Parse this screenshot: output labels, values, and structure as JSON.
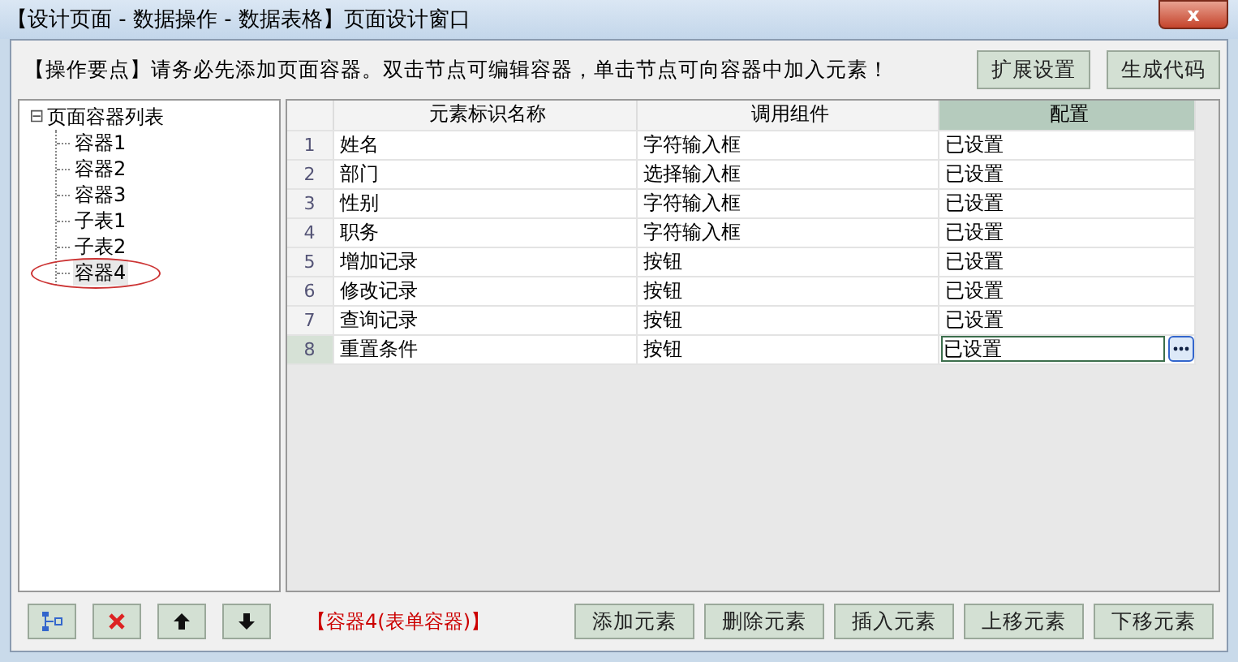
{
  "window": {
    "title": "【设计页面 - 数据操作 - 数据表格】页面设计窗口",
    "close": "x"
  },
  "hint": {
    "label": "【操作要点】",
    "text": "请务必先添加页面容器。双击节点可编辑容器，单击节点可向容器中加入元素！"
  },
  "top_buttons": [
    "扩展设置",
    "生成代码"
  ],
  "tree": {
    "label": "页面容器列表",
    "toggle": "⊟",
    "expanded": true,
    "children": [
      {
        "label": "容器1",
        "selected": false
      },
      {
        "label": "容器2",
        "selected": false
      },
      {
        "label": "容器3",
        "selected": false
      },
      {
        "label": "子表1",
        "selected": false
      },
      {
        "label": "子表2",
        "selected": false
      },
      {
        "label": "容器4",
        "selected": true
      }
    ]
  },
  "table": {
    "columns": [
      {
        "label": "元素标识名称",
        "selected": false
      },
      {
        "label": "调用组件",
        "selected": false
      },
      {
        "label": "配置",
        "selected": true
      }
    ],
    "rows": [
      {
        "index": "1",
        "name": "姓名",
        "component": "字符输入框",
        "config": "已设置",
        "selected": false
      },
      {
        "index": "2",
        "name": "部门",
        "component": "选择输入框",
        "config": "已设置",
        "selected": false
      },
      {
        "index": "3",
        "name": "性别",
        "component": "字符输入框",
        "config": "已设置",
        "selected": false
      },
      {
        "index": "4",
        "name": "职务",
        "component": "字符输入框",
        "config": "已设置",
        "selected": false
      },
      {
        "index": "5",
        "name": "增加记录",
        "component": "按钮",
        "config": "已设置",
        "selected": false
      },
      {
        "index": "6",
        "name": "修改记录",
        "component": "按钮",
        "config": "已设置",
        "selected": false
      },
      {
        "index": "7",
        "name": "查询记录",
        "component": "按钮",
        "config": "已设置",
        "selected": false
      },
      {
        "index": "8",
        "name": "重置条件",
        "component": "按钮",
        "config": "已设置",
        "selected": true
      }
    ]
  },
  "tool_buttons": [
    {
      "kind": "add"
    },
    {
      "kind": "delete"
    },
    {
      "kind": "up"
    },
    {
      "kind": "down"
    }
  ],
  "status": "【容器4(表单容器)】",
  "bottom_buttons": [
    "添加元素",
    "删除元素",
    "插入元素",
    "上移元素",
    "下移元素"
  ]
}
